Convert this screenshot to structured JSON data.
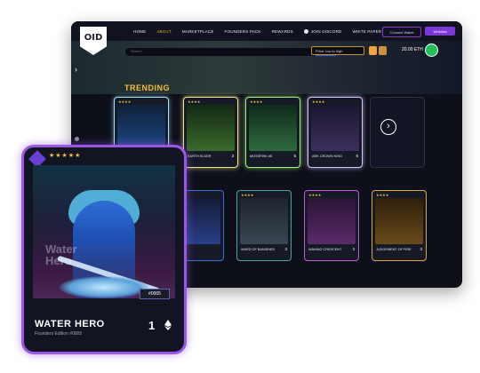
{
  "nav": {
    "logo": "OID",
    "items": [
      "HOME",
      "ABOUT",
      "MARKETPLACE",
      "FOUNDERS PACK",
      "REWARDS"
    ],
    "discord": "JOIN DISCORD",
    "whitepaper": "WHITE PAPER",
    "connect": "Connect Wallet",
    "whitelist": "Whitelist"
  },
  "toolbar": {
    "search_placeholder": "Search",
    "search_button": "SEARCH",
    "sort": "Price: low to high",
    "eth_balance": "20.00 ETH"
  },
  "trending": {
    "title": "TRENDING",
    "cards": [
      {
        "name": "",
        "price": "",
        "art": "#1d4a8a"
      },
      {
        "name": "EARTH ELDER",
        "price": "3",
        "art": "#3a6a2a"
      },
      {
        "name": "MOSSFINK #5",
        "price": "5",
        "art": "#2e6b3e"
      },
      {
        "name": "ARK CROWN KING",
        "price": "5",
        "art": "#3d2f5c"
      }
    ]
  },
  "grid": {
    "cards": [
      {
        "name": "R HERO",
        "price": "",
        "art": "#2a3f88"
      },
      {
        "name": "WARD OF BANISHED",
        "price": "3",
        "art": "#3b4652"
      },
      {
        "name": "WANING CRESCENT",
        "price": "3",
        "art": "#5a2a6a"
      },
      {
        "name": "JUDGEMENT OF FIRE",
        "price": "3",
        "art": "#6a4a1a"
      }
    ]
  },
  "featured": {
    "stars": "★★★★★",
    "ghost_title": "Water Hero",
    "id": "#0005",
    "title": "WATER HERO",
    "subtitle": "Founders Edition #0005",
    "price": "1"
  },
  "colors": {
    "accent_gold": "#f4c038",
    "accent_purple": "#9a57e6"
  }
}
